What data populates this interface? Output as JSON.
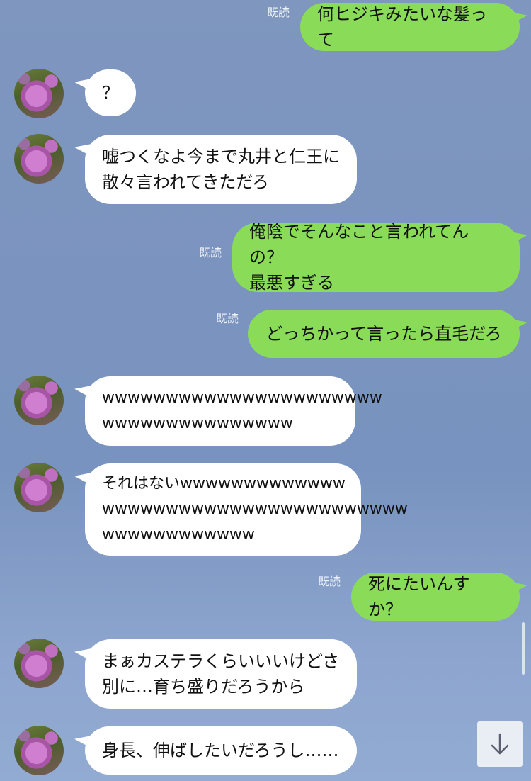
{
  "read_label": "既読",
  "messages": [
    {
      "from": "me",
      "text": "何ヒジキみたいな髪って",
      "read": true
    },
    {
      "from": "them",
      "text": "？"
    },
    {
      "from": "them",
      "text": "嘘つくなよ今まで丸井と仁王に\n散々言われてきただろ"
    },
    {
      "from": "me",
      "text": "俺陰でそんなこと言われてんの？\n最悪すぎる",
      "read": true
    },
    {
      "from": "me",
      "text": "どっちかって言ったら直毛だろ",
      "read": true
    },
    {
      "from": "them",
      "text": "wwwwwwwwwwwwwwwwwwwwww\nwwwwwwwwwwwwwww"
    },
    {
      "from": "them",
      "text": "それはないwwwwwwwwwwwww\nwwwwwwwwwwwwwwwwwwwwwwww\nwwwwwwwwwwww"
    },
    {
      "from": "me",
      "text": "死にたいんすか？",
      "read": true
    },
    {
      "from": "them",
      "text": "まぁカステラくらいいいけどさ\n別に…育ち盛りだろうから"
    },
    {
      "from": "them",
      "text": "身長、伸ばしたいだろうし……"
    }
  ],
  "scroll_button_icon": "arrow-down-icon"
}
